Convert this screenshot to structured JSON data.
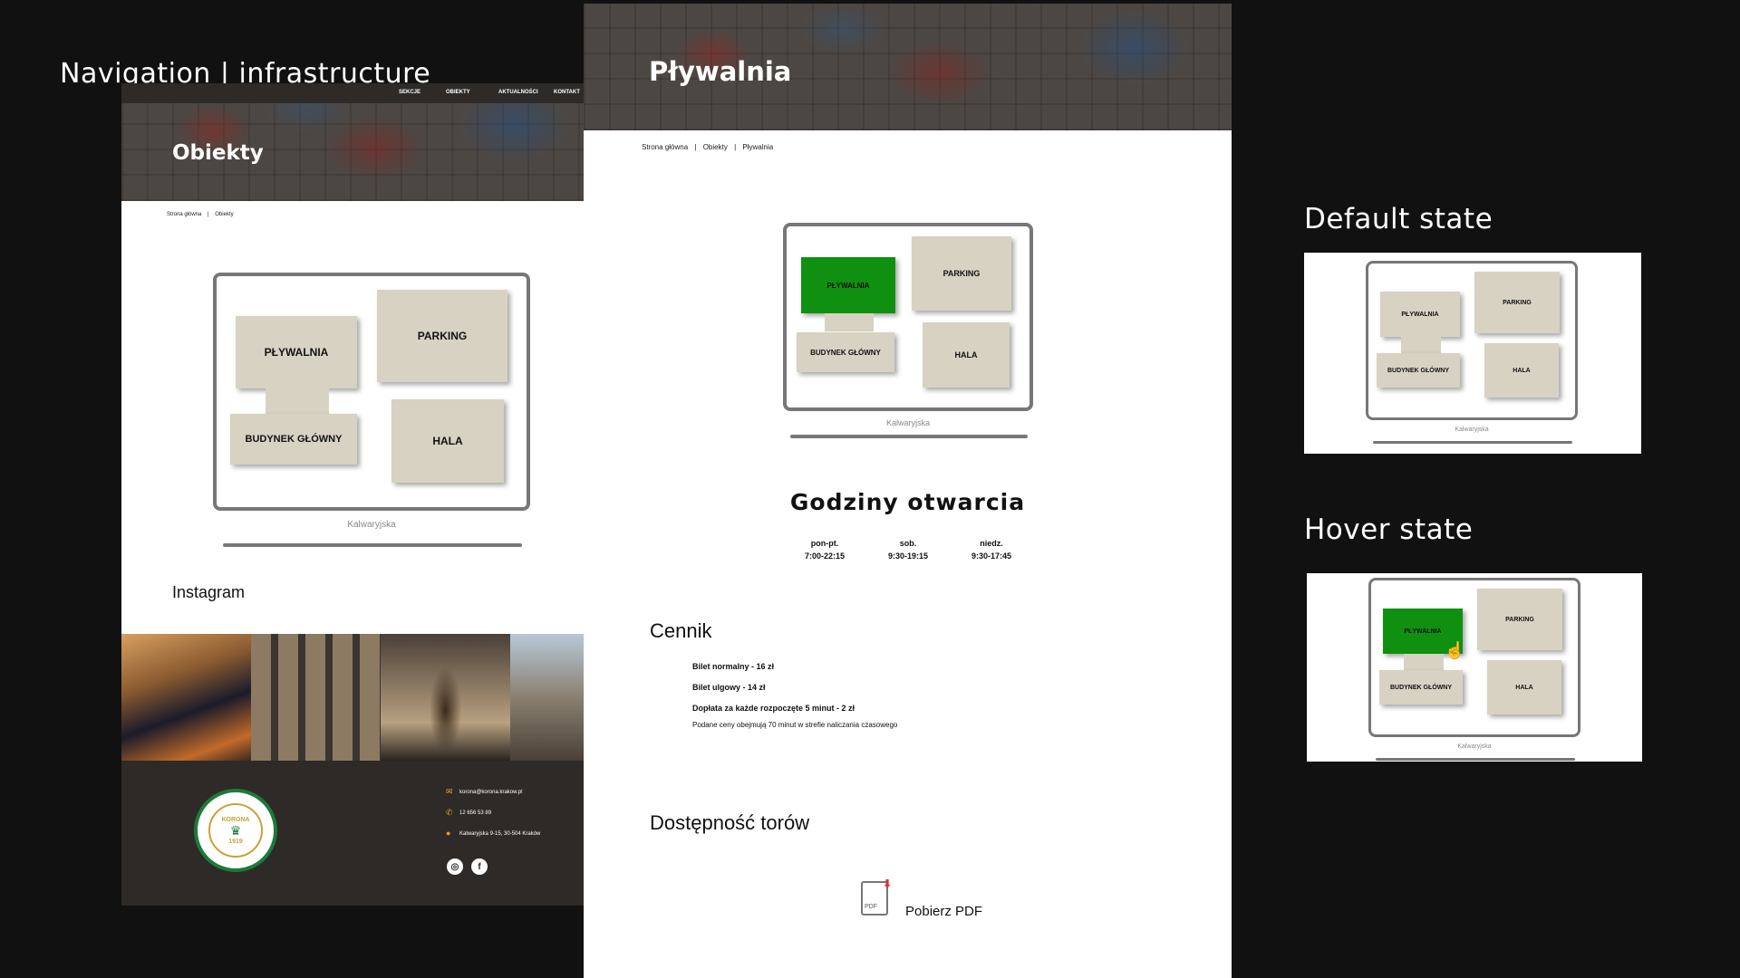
{
  "slide": {
    "title": "Navigation | infrastructure",
    "default_state_label": "Default state",
    "hover_state_label": "Hover state"
  },
  "colors": {
    "background": "#111111",
    "tile": "#d8d2c2",
    "tile_hover": "#109010",
    "footer": "#2d2a27"
  },
  "objects_page": {
    "nav": [
      "SEKCJE",
      "OBIEKTY",
      "AKTUALNOŚCI",
      "KONTAKT"
    ],
    "banner_title": "Obiekty",
    "breadcrumb": [
      "Strona główna",
      "|",
      "Obiekty"
    ],
    "map": {
      "tiles": {
        "pool": "PŁYWALNIA",
        "parking": "PARKING",
        "main": "BUDYNEK GŁÓWNY",
        "hall": "HALA"
      },
      "street": "Kalwaryjska"
    },
    "instagram_heading": "Instagram",
    "footer": {
      "email": "korona@korona.krakow.pl",
      "phone": "12 656 53 89",
      "address": "Kalwaryjska 9-15, 30-504 Kraków",
      "badge_top": "KORONA",
      "badge_year": "1919"
    }
  },
  "pool_page": {
    "banner_title": "Pływalnia",
    "breadcrumb": [
      "Strona główna",
      "|",
      "Obiekty",
      "|",
      "Pływalnia"
    ],
    "map": {
      "tiles": {
        "pool": "PŁYWALNIA",
        "parking": "PARKING",
        "main": "BUDYNEK GŁÓWNY",
        "hall": "HALA"
      },
      "street": "Kalwaryjska"
    },
    "hours_heading": "Godziny otwarcia",
    "hours": [
      {
        "days": "pon-pt.",
        "time": "7:00-22:15"
      },
      {
        "days": "sob.",
        "time": "9:30-19:15"
      },
      {
        "days": "niedz.",
        "time": "9:30-17:45"
      }
    ],
    "pricing_heading": "Cennik",
    "prices": [
      "Bilet normalny - 16 zł",
      "Bilet ulgowy - 14 zł",
      "Dopłata za każde rozpoczęte 5 minut - 2 zł"
    ],
    "price_note": "Podane ceny obejmują 70 minut w strefie naliczania czasowego",
    "lanes_heading": "Dostępność torów",
    "pdf_icon_text": "PDF",
    "pdf_link": "Pobierz PDF"
  },
  "states": {
    "tiles": {
      "pool": "PŁYWALNIA",
      "parking": "PARKING",
      "main": "BUDYNEK GŁÓWNY",
      "hall": "HALA"
    },
    "street": "Kalwaryjska"
  }
}
